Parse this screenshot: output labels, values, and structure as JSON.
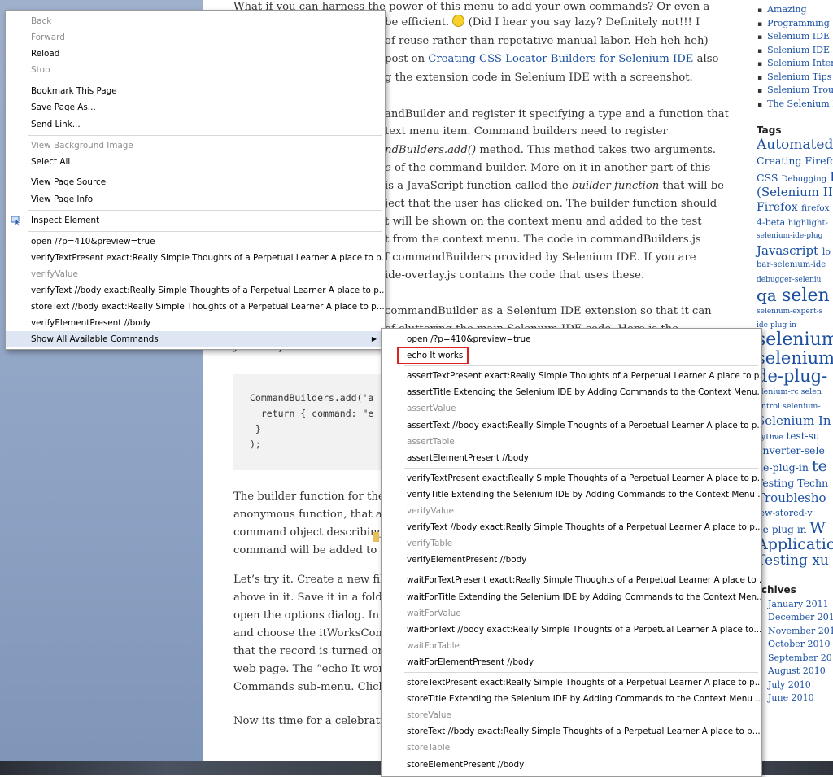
{
  "article": {
    "lines": [
      "What if you can harness the power of this menu to add your own commands? Or even a",
      "be efficient.",
      "(Did I hear you say lazy? Definitely not!!! I",
      "of reuse rather than repetative manual labor. Heh heh heh)",
      "post on",
      "Creating CSS Locator Builders for Selenium IDE",
      "also",
      "g the extension code in Selenium IDE with a screenshot.",
      "andBuilder and register it specifying a type and a function that",
      "text menu item. Command builders need to register",
      "ndBuilders.add()",
      "method. This method takes two arguments.",
      "e",
      "of the command builder. More on it in another part of this",
      "is a JavaScript function called the",
      "builder function",
      "that will be",
      "ject that the user has clicked on.  The builder function should",
      "t will be shown on the context menu and added to the test",
      "t from the context menu. The code in commandBuilders.js",
      "f commandBuilders provided by Selenium IDE. If you are",
      "ide-overlay.js contains the code that uses these.",
      "commandBuilder as a Selenium IDE extension so that it can",
      "of cluttering the main Selenium IDE code. Here is the",
      "JavaScript code for the \"It w",
      "The builder function for the",
      "anonymous function, that ac",
      "command object describing",
      "command will be added to th",
      "Let’s try it. Create a new file",
      "above in it. Save it in a folde",
      "open the options dialog. In th",
      "and choose the itWorksCom",
      "that the record is turned on",
      "web page. The “echo It work",
      "Commands sub-menu. Click",
      "Now its time for a celebratio"
    ],
    "code": [
      "CommandBuilders.add('a",
      "  return { command: \"e",
      " }",
      ");"
    ]
  },
  "sidebar": {
    "categories": [
      "Amazing",
      "Programming",
      "Selenium IDE P",
      "Selenium IDE P",
      "Selenium Inter",
      "Selenium Tips",
      "Selenium Trou",
      "The Selenium B"
    ],
    "tags_heading": "Tags",
    "tags": [
      "Automated",
      "Creating Firefo",
      "CSS",
      "Debugging",
      "F",
      "(Selenium II",
      "Firefox",
      "firefox",
      "4-beta",
      "highlight-",
      "selenium-ide-plug",
      "Javascript",
      "lo",
      "bar-selenium-ide",
      "debugger-seleniu",
      "qa",
      "selen",
      "selenium-expert-s",
      "ide-plug-in",
      "selenium",
      "selenium",
      "de-plug-",
      "elenium-rc",
      "selen",
      "ontrol",
      "selenium-",
      "Selenium In",
      "kyDive",
      "test-su",
      "onverter-sele",
      "de-plug-in",
      "te",
      "Testing",
      "Techn",
      "Troublesho",
      "iew-stored-v",
      "de-plug-in",
      "W",
      "Applicatio",
      "Testing",
      "xu"
    ],
    "archives_heading": "rchives",
    "archives": [
      "January 2011",
      "December 2010",
      "November 201",
      "October 2010",
      "September 201",
      "August 2010",
      "July 2010",
      "June 2010"
    ]
  },
  "menu": {
    "back": "Back",
    "forward": "Forward",
    "reload": "Reload",
    "stop": "Stop",
    "bookmark": "Bookmark This Page",
    "save_page": "Save Page As...",
    "send_link": "Send Link...",
    "view_bg": "View Background Image",
    "select_all": "Select All",
    "view_source": "View Page Source",
    "view_info": "View Page Info",
    "inspect": "Inspect Element",
    "cmd_open": "open /?p=410&preview=true",
    "cmd_verify_text_present": "verifyTextPresent exact:Really Simple Thoughts of a Perpetual Learner  A place to p...",
    "cmd_verify_value": "verifyValue",
    "cmd_verify_text": "verifyText //body exact:Really Simple Thoughts of a Perpetual Learner  A place to p...",
    "cmd_store_text": "storeText //body exact:Really Simple Thoughts of a Perpetual Learner  A place to p...",
    "cmd_verify_element_present": "verifyElementPresent //body",
    "show_all": "Show All Available Commands"
  },
  "submenu": {
    "items": [
      {
        "label": "open /?p=410&preview=true",
        "disabled": false
      },
      {
        "label": "echo It works",
        "disabled": false
      },
      {
        "sep": true
      },
      {
        "label": "assertTextPresent exact:Really Simple Thoughts of a Perpetual Learner  A place to p...",
        "disabled": false
      },
      {
        "label": "assertTitle Extending the Selenium IDE by Adding Commands to the Context Menu...",
        "disabled": false
      },
      {
        "label": "assertValue",
        "disabled": true
      },
      {
        "label": "assertText //body exact:Really Simple Thoughts of a Perpetual Learner  A place to p...",
        "disabled": false
      },
      {
        "label": "assertTable",
        "disabled": true
      },
      {
        "label": "assertElementPresent //body",
        "disabled": false
      },
      {
        "sep": true
      },
      {
        "label": "verifyTextPresent exact:Really Simple Thoughts of a Perpetual Learner  A place to p...",
        "disabled": false
      },
      {
        "label": "verifyTitle Extending the Selenium IDE by Adding Commands to the Context Menu ...",
        "disabled": false
      },
      {
        "label": "verifyValue",
        "disabled": true
      },
      {
        "label": "verifyText //body exact:Really Simple Thoughts of a Perpetual Learner  A place to p...",
        "disabled": false
      },
      {
        "label": "verifyTable",
        "disabled": true
      },
      {
        "label": "verifyElementPresent //body",
        "disabled": false
      },
      {
        "sep": true
      },
      {
        "label": "waitForTextPresent exact:Really Simple Thoughts of a Perpetual Learner  A place to ...",
        "disabled": false
      },
      {
        "label": "waitForTitle Extending the Selenium IDE by Adding Commands to the Context Men...",
        "disabled": false
      },
      {
        "label": "waitForValue",
        "disabled": true
      },
      {
        "label": "waitForText //body exact:Really Simple Thoughts of a Perpetual Learner  A place to...",
        "disabled": false
      },
      {
        "label": "waitForTable",
        "disabled": true
      },
      {
        "label": "waitForElementPresent //body",
        "disabled": false
      },
      {
        "sep": true
      },
      {
        "label": "storeTextPresent exact:Really Simple Thoughts of a Perpetual Learner  A place to p...",
        "disabled": false
      },
      {
        "label": "storeTitle Extending the Selenium IDE by Adding Commands to the Context Menu ...",
        "disabled": false
      },
      {
        "label": "storeValue",
        "disabled": true
      },
      {
        "label": "storeText //body exact:Really Simple Thoughts of a Perpetual Learner  A place to p...",
        "disabled": false
      },
      {
        "label": "storeTable",
        "disabled": true
      },
      {
        "label": "storeElementPresent //body",
        "disabled": false
      }
    ]
  }
}
